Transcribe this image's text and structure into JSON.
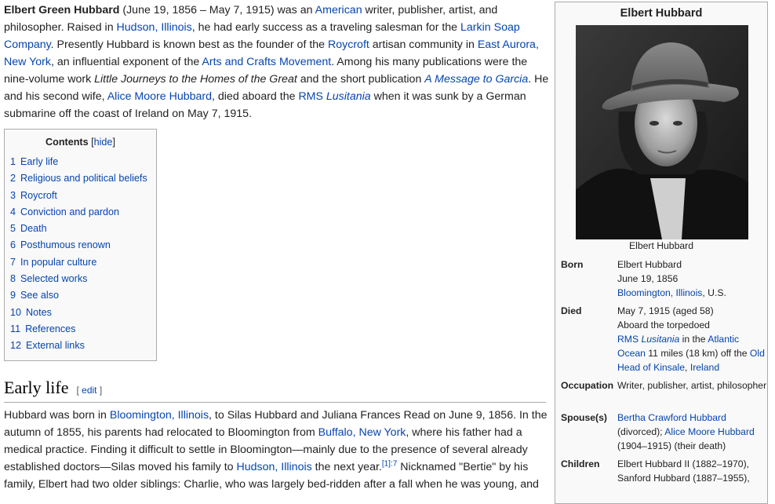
{
  "lead": {
    "bold_name": "Elbert Green Hubbard",
    "t1": " (June 19, 1856 – May 7, 1915) was an ",
    "l_american": "American",
    "t2": " writer, publisher, artist, and philosopher. Raised in ",
    "l_hudson": "Hudson, Illinois",
    "t3": ", he had early success as a traveling salesman for the ",
    "l_larkin": "Larkin Soap Company",
    "t4": ". Presently Hubbard is known best as the founder of the ",
    "l_roycroft": "Roycroft",
    "t5": " artisan community in ",
    "l_east_aurora": "East Aurora, New York",
    "t6": ", an influential exponent of the ",
    "l_arts_crafts": "Arts and Crafts Movement",
    "t7": ". Among his many publications were the nine-volume work ",
    "i_little_journeys": "Little Journeys to the Homes of the Great",
    "t8": " and the short publication ",
    "l_message": "A Message to Garcia",
    "t9": ". He and his second wife, ",
    "l_alice": "Alice Moore Hubbard",
    "t10": ", died aboard the ",
    "l_rms": "RMS ",
    "l_lusitania": "Lusitania",
    "t11": " when it was sunk by a German submarine off the coast of Ireland on May 7, 1915."
  },
  "toc": {
    "title": "Contents",
    "hide_open": "[",
    "hide": "hide",
    "hide_close": "]",
    "items": [
      {
        "num": "1",
        "label": "Early life"
      },
      {
        "num": "2",
        "label": "Religious and political beliefs"
      },
      {
        "num": "3",
        "label": "Roycroft"
      },
      {
        "num": "4",
        "label": "Conviction and pardon"
      },
      {
        "num": "5",
        "label": "Death"
      },
      {
        "num": "6",
        "label": "Posthumous renown"
      },
      {
        "num": "7",
        "label": "In popular culture"
      },
      {
        "num": "8",
        "label": "Selected works"
      },
      {
        "num": "9",
        "label": "See also"
      },
      {
        "num": "10",
        "label": "Notes"
      },
      {
        "num": "11",
        "label": "References"
      },
      {
        "num": "12",
        "label": "External links"
      }
    ]
  },
  "section": {
    "heading": "Early life",
    "edit_open": "[ ",
    "edit": "edit",
    "edit_close": " ]",
    "t1": "Hubbard was born in ",
    "l_bloomington": "Bloomington, Illinois",
    "t2": ", to Silas Hubbard and Juliana Frances Read on June 9, 1856. In the autumn of 1855, his parents had relocated to Bloomington from ",
    "l_buffalo": "Buffalo, New York",
    "t3": ", where his father had a medical practice. Finding it difficult to settle in Bloomington—mainly due to the presence of several already established doctors—Silas moved his family to ",
    "l_hudson": "Hudson, Illinois",
    "t4": " the next year.",
    "ref": "[1]:7",
    "t5": " Nicknamed \"Bertie\" by his family, Elbert had two older siblings: Charlie, who was largely bed-ridden after a fall when he was young, and"
  },
  "infobox": {
    "title": "Elbert Hubbard",
    "caption": "Elbert Hubbard",
    "born_label": "Born",
    "born_name": "Elbert Hubbard",
    "born_date": "June 19, 1856",
    "born_place_link": "Bloomington, Illinois",
    "born_place_rest": ", U.S.",
    "died_label": "Died",
    "died_date": "May 7, 1915 (aged 58)",
    "died_l2": "Aboard the torpedoed",
    "died_rms": "RMS ",
    "died_lusitania": "Lusitania",
    "died_in": " in the ",
    "died_atlantic": "Atlantic Ocean",
    "died_dist": " 11 miles (18 km) off the ",
    "died_kinsale": "Old Head of Kinsale",
    "died_comma": ", ",
    "died_ireland": "Ireland",
    "occ_label": "Occupation",
    "occ_value": "Writer, publisher, artist, philosopher",
    "spouse_label": "Spouse(s)",
    "spouse1": "Bertha Crawford Hubbard",
    "spouse1_note": "(divorced); ",
    "spouse2": "Alice Moore Hubbard",
    "spouse2_note": "(1904–1915) (their death)",
    "children_label": "Children",
    "child1": "Elbert Hubbard II (1882–1970),",
    "child2": "Sanford Hubbard (1887–1955),"
  }
}
